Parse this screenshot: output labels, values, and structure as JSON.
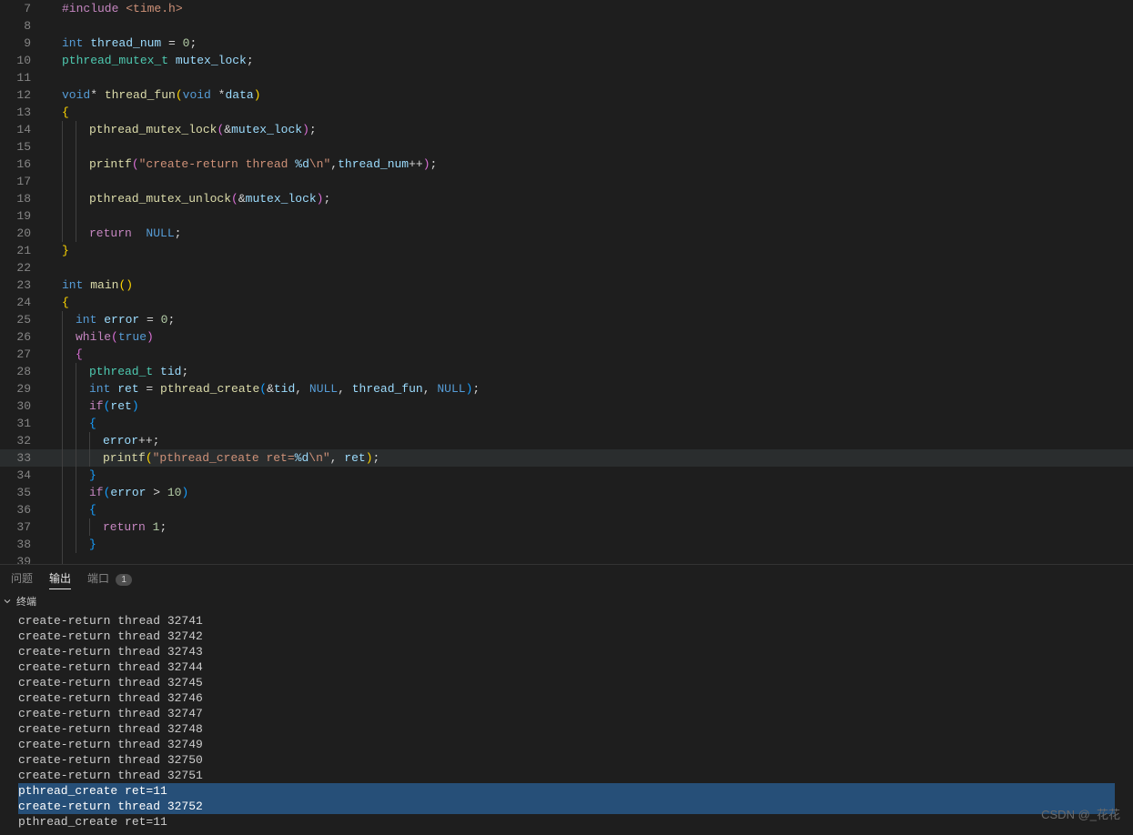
{
  "gutter_start": 7,
  "lines_count": 33,
  "highlighted_line": 33,
  "code_tokens": [
    [
      {
        "t": "#include ",
        "c": "c"
      },
      {
        "t": "<time.h>",
        "c": "str"
      }
    ],
    [],
    [
      {
        "t": "int",
        "c": "kw"
      },
      {
        "t": " "
      },
      {
        "t": "thread_num",
        "c": "var"
      },
      {
        "t": " = "
      },
      {
        "t": "0",
        "c": "num"
      },
      {
        "t": ";"
      }
    ],
    [
      {
        "t": "pthread_mutex_t",
        "c": "typ"
      },
      {
        "t": " "
      },
      {
        "t": "mutex_lock",
        "c": "var"
      },
      {
        "t": ";"
      }
    ],
    [],
    [
      {
        "t": "void",
        "c": "kw"
      },
      {
        "t": "* "
      },
      {
        "t": "thread_fun",
        "c": "fn"
      },
      {
        "t": "(",
        "c": "br"
      },
      {
        "t": "void",
        "c": "kw"
      },
      {
        "t": " *"
      },
      {
        "t": "data",
        "c": "var"
      },
      {
        "t": ")",
        "c": "br"
      }
    ],
    [
      {
        "t": "{",
        "c": "br"
      }
    ],
    [
      {
        "g": 2
      },
      {
        "t": "pthread_mutex_lock",
        "c": "fn"
      },
      {
        "t": "(",
        "c": "br2"
      },
      {
        "t": "&"
      },
      {
        "t": "mutex_lock",
        "c": "var"
      },
      {
        "t": ")",
        "c": "br2"
      },
      {
        "t": ";"
      }
    ],
    [
      {
        "g": 2
      }
    ],
    [
      {
        "g": 2
      },
      {
        "t": "printf",
        "c": "fn"
      },
      {
        "t": "(",
        "c": "br2"
      },
      {
        "t": "\"create-return thread ",
        "c": "str"
      },
      {
        "t": "%d",
        "c": "fmt"
      },
      {
        "t": "\\n\"",
        "c": "str"
      },
      {
        "t": ","
      },
      {
        "t": "thread_num",
        "c": "var"
      },
      {
        "t": "++"
      },
      {
        "t": ")",
        "c": "br2"
      },
      {
        "t": ";"
      }
    ],
    [
      {
        "g": 2
      }
    ],
    [
      {
        "g": 2
      },
      {
        "t": "pthread_mutex_unlock",
        "c": "fn"
      },
      {
        "t": "(",
        "c": "br2"
      },
      {
        "t": "&"
      },
      {
        "t": "mutex_lock",
        "c": "var"
      },
      {
        "t": ")",
        "c": "br2"
      },
      {
        "t": ";"
      }
    ],
    [
      {
        "g": 2
      }
    ],
    [
      {
        "g": 2
      },
      {
        "t": "return",
        "c": "c"
      },
      {
        "t": "  "
      },
      {
        "t": "NULL",
        "c": "kw"
      },
      {
        "t": ";"
      }
    ],
    [
      {
        "t": "}",
        "c": "br"
      }
    ],
    [],
    [
      {
        "t": "int",
        "c": "kw"
      },
      {
        "t": " "
      },
      {
        "t": "main",
        "c": "fn"
      },
      {
        "t": "(",
        "c": "br"
      },
      {
        "t": ")",
        "c": "br"
      }
    ],
    [
      {
        "t": "{",
        "c": "br"
      }
    ],
    [
      {
        "g": 1
      },
      {
        "t": "int",
        "c": "kw"
      },
      {
        "t": " "
      },
      {
        "t": "error",
        "c": "var"
      },
      {
        "t": " = "
      },
      {
        "t": "0",
        "c": "num"
      },
      {
        "t": ";"
      }
    ],
    [
      {
        "g": 1
      },
      {
        "t": "while",
        "c": "c"
      },
      {
        "t": "(",
        "c": "br2"
      },
      {
        "t": "true",
        "c": "kw"
      },
      {
        "t": ")",
        "c": "br2"
      }
    ],
    [
      {
        "g": 1
      },
      {
        "t": "{",
        "c": "br2"
      }
    ],
    [
      {
        "g": 2
      },
      {
        "t": "pthread_t",
        "c": "typ"
      },
      {
        "t": " "
      },
      {
        "t": "tid",
        "c": "var"
      },
      {
        "t": ";"
      }
    ],
    [
      {
        "g": 2
      },
      {
        "t": "int",
        "c": "kw"
      },
      {
        "t": " "
      },
      {
        "t": "ret",
        "c": "var"
      },
      {
        "t": " = "
      },
      {
        "t": "pthread_create",
        "c": "fn"
      },
      {
        "t": "(",
        "c": "br3"
      },
      {
        "t": "&"
      },
      {
        "t": "tid",
        "c": "var"
      },
      {
        "t": ", "
      },
      {
        "t": "NULL",
        "c": "kw"
      },
      {
        "t": ", "
      },
      {
        "t": "thread_fun",
        "c": "var"
      },
      {
        "t": ", "
      },
      {
        "t": "NULL",
        "c": "kw"
      },
      {
        "t": ")",
        "c": "br3"
      },
      {
        "t": ";"
      }
    ],
    [
      {
        "g": 2
      },
      {
        "t": "if",
        "c": "c"
      },
      {
        "t": "(",
        "c": "br3"
      },
      {
        "t": "ret",
        "c": "var"
      },
      {
        "t": ")",
        "c": "br3"
      }
    ],
    [
      {
        "g": 2
      },
      {
        "t": "{",
        "c": "br3"
      }
    ],
    [
      {
        "g": 3
      },
      {
        "t": "error",
        "c": "var"
      },
      {
        "t": "++;"
      }
    ],
    [
      {
        "g": 3
      },
      {
        "t": "printf",
        "c": "fn"
      },
      {
        "t": "(",
        "c": "br"
      },
      {
        "t": "\"pthread_create ret=",
        "c": "str"
      },
      {
        "t": "%d",
        "c": "fmt"
      },
      {
        "t": "\\n\"",
        "c": "str"
      },
      {
        "t": ", "
      },
      {
        "t": "ret",
        "c": "var"
      },
      {
        "t": ")",
        "c": "br"
      },
      {
        "t": ";"
      }
    ],
    [
      {
        "g": 2
      },
      {
        "t": "}",
        "c": "br3"
      }
    ],
    [
      {
        "g": 2
      },
      {
        "t": "if",
        "c": "c"
      },
      {
        "t": "(",
        "c": "br3"
      },
      {
        "t": "error",
        "c": "var"
      },
      {
        "t": " > "
      },
      {
        "t": "10",
        "c": "num"
      },
      {
        "t": ")",
        "c": "br3"
      }
    ],
    [
      {
        "g": 2
      },
      {
        "t": "{",
        "c": "br3"
      }
    ],
    [
      {
        "g": 3
      },
      {
        "t": "return",
        "c": "c"
      },
      {
        "t": " "
      },
      {
        "t": "1",
        "c": "num"
      },
      {
        "t": ";"
      }
    ],
    [
      {
        "g": 2
      },
      {
        "t": "}",
        "c": "br3"
      }
    ],
    [
      {
        "g": 1
      }
    ]
  ],
  "tabs": {
    "problems": "问题",
    "output": "输出",
    "ports": "端口",
    "ports_badge": "1"
  },
  "section": {
    "label": "终端"
  },
  "terminal_lines": [
    {
      "text": "create-return thread 32741",
      "sel": false
    },
    {
      "text": "create-return thread 32742",
      "sel": false
    },
    {
      "text": "create-return thread 32743",
      "sel": false
    },
    {
      "text": "create-return thread 32744",
      "sel": false
    },
    {
      "text": "create-return thread 32745",
      "sel": false
    },
    {
      "text": "create-return thread 32746",
      "sel": false
    },
    {
      "text": "create-return thread 32747",
      "sel": false
    },
    {
      "text": "create-return thread 32748",
      "sel": false
    },
    {
      "text": "create-return thread 32749",
      "sel": false
    },
    {
      "text": "create-return thread 32750",
      "sel": false
    },
    {
      "text": "create-return thread 32751",
      "sel": false
    },
    {
      "text": "pthread_create ret=11",
      "sel": true
    },
    {
      "text": "create-return thread 32752",
      "sel": true
    },
    {
      "text": "pthread_create ret=11",
      "sel": false
    }
  ],
  "watermark": "CSDN @_花花"
}
